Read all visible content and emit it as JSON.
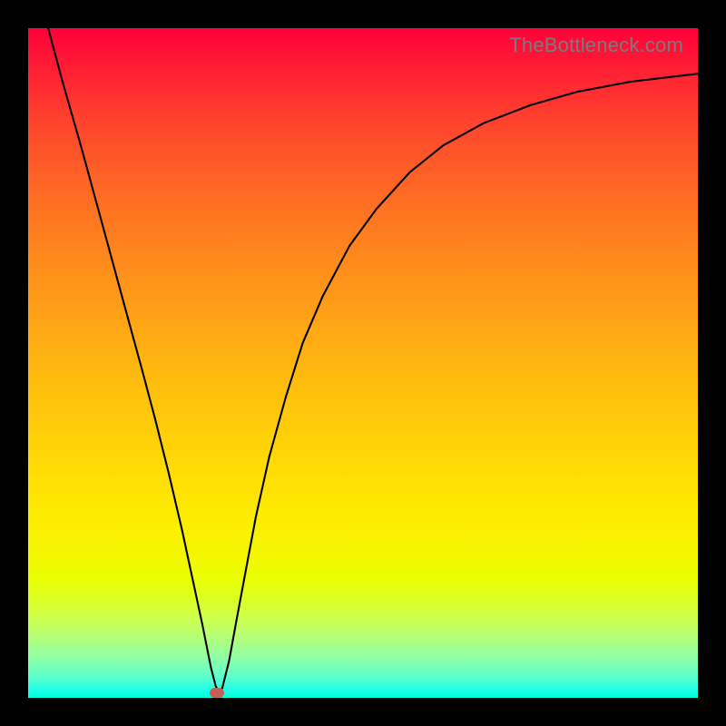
{
  "watermark": "TheBottleneck.com",
  "chart_data": {
    "type": "line",
    "title": "",
    "xlabel": "",
    "ylabel": "",
    "xlim": [
      0,
      100
    ],
    "ylim": [
      0,
      100
    ],
    "grid": false,
    "legend": false,
    "curve_points_percent": [
      [
        3.0,
        100.0
      ],
      [
        5.0,
        92.5
      ],
      [
        8.0,
        82.0
      ],
      [
        11.0,
        71.0
      ],
      [
        14.0,
        60.0
      ],
      [
        17.0,
        49.0
      ],
      [
        19.0,
        41.5
      ],
      [
        21.0,
        33.5
      ],
      [
        23.0,
        25.0
      ],
      [
        24.5,
        18.0
      ],
      [
        26.0,
        11.0
      ],
      [
        27.3,
        4.5
      ],
      [
        28.0,
        1.8
      ],
      [
        28.5,
        0.7
      ],
      [
        29.0,
        1.5
      ],
      [
        30.0,
        5.5
      ],
      [
        31.0,
        11.0
      ],
      [
        32.5,
        19.0
      ],
      [
        34.0,
        27.0
      ],
      [
        36.0,
        36.0
      ],
      [
        38.5,
        45.0
      ],
      [
        41.0,
        53.0
      ],
      [
        44.0,
        60.0
      ],
      [
        48.0,
        67.5
      ],
      [
        52.0,
        73.0
      ],
      [
        57.0,
        78.5
      ],
      [
        62.0,
        82.5
      ],
      [
        68.0,
        85.8
      ],
      [
        75.0,
        88.5
      ],
      [
        82.0,
        90.5
      ],
      [
        90.0,
        92.0
      ],
      [
        100.0,
        93.2
      ]
    ],
    "marker": {
      "x_percent": 28.2,
      "y_percent": 0.7,
      "color": "#c36057"
    },
    "gradient_stops": [
      {
        "pos": 0,
        "color": "#ff003a"
      },
      {
        "pos": 50,
        "color": "#ffb300"
      },
      {
        "pos": 78,
        "color": "#f5f800"
      },
      {
        "pos": 100,
        "color": "#00ffe0"
      }
    ]
  }
}
